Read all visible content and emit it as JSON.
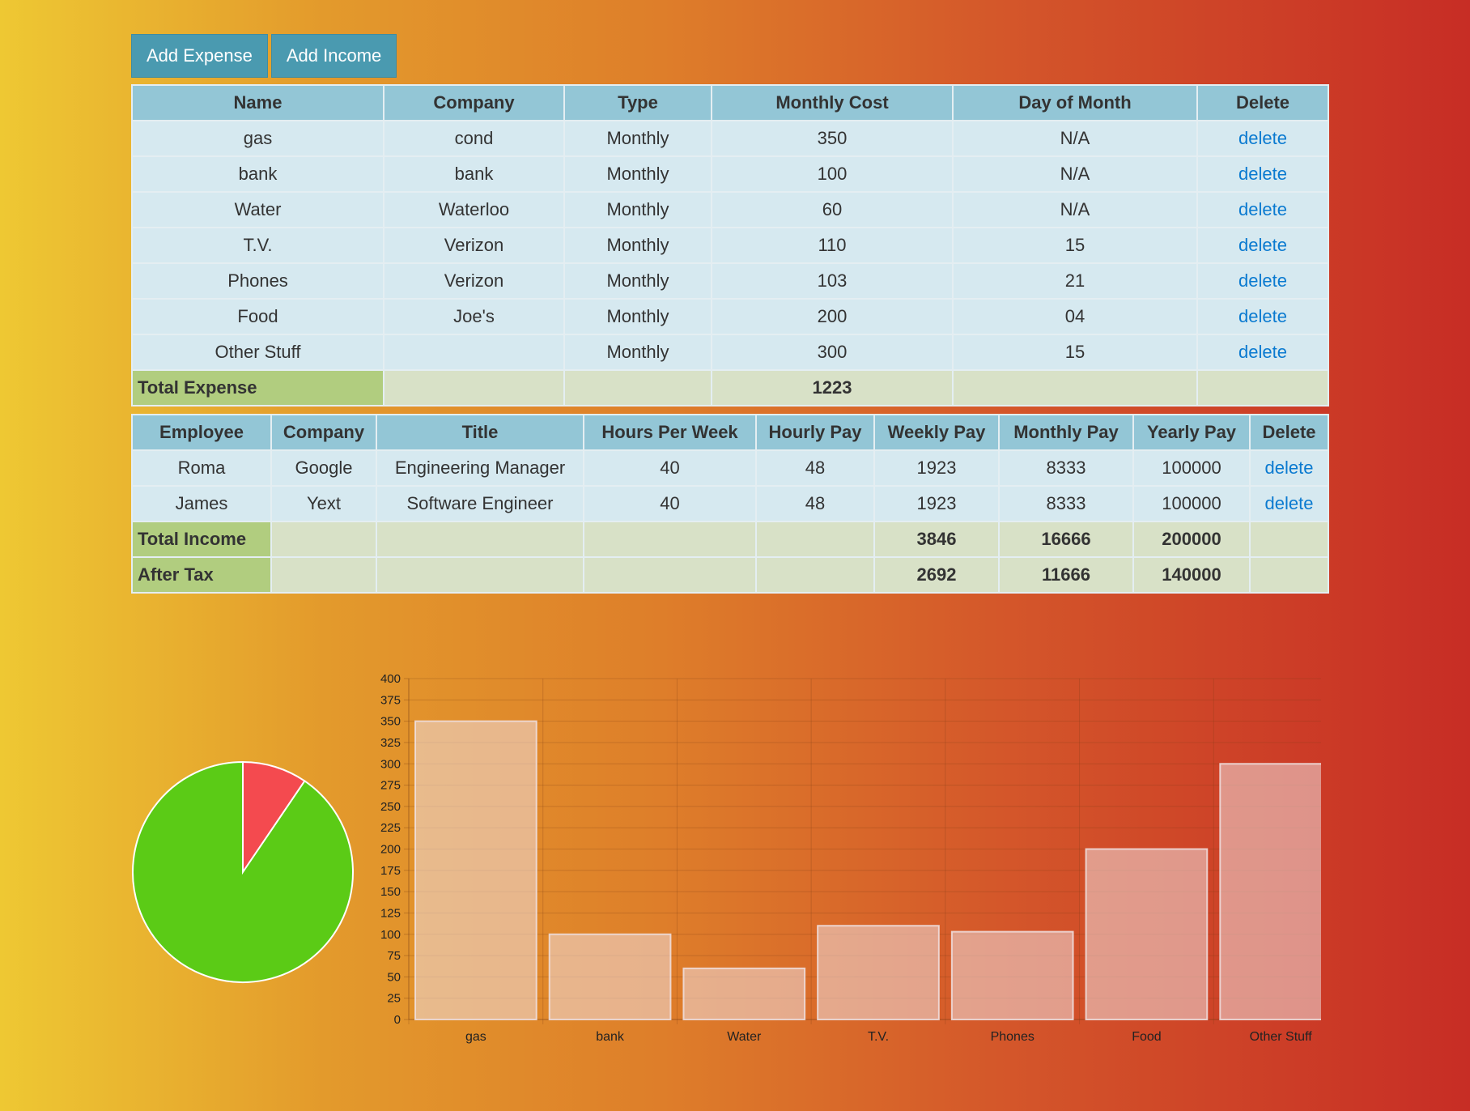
{
  "buttons": {
    "add_expense": "Add Expense",
    "add_income": "Add Income"
  },
  "expenses": {
    "headers": [
      "Name",
      "Company",
      "Type",
      "Monthly Cost",
      "Day of Month",
      "Delete"
    ],
    "rows": [
      {
        "name": "gas",
        "company": "cond",
        "type": "Monthly",
        "cost": "350",
        "day": "N/A",
        "action": "delete"
      },
      {
        "name": "bank",
        "company": "bank",
        "type": "Monthly",
        "cost": "100",
        "day": "N/A",
        "action": "delete"
      },
      {
        "name": "Water",
        "company": "Waterloo",
        "type": "Monthly",
        "cost": "60",
        "day": "N/A",
        "action": "delete"
      },
      {
        "name": "T.V.",
        "company": "Verizon",
        "type": "Monthly",
        "cost": "110",
        "day": "15",
        "action": "delete"
      },
      {
        "name": "Phones",
        "company": "Verizon",
        "type": "Monthly",
        "cost": "103",
        "day": "21",
        "action": "delete"
      },
      {
        "name": "Food",
        "company": "Joe's",
        "type": "Monthly",
        "cost": "200",
        "day": "04",
        "action": "delete"
      },
      {
        "name": "Other Stuff",
        "company": "",
        "type": "Monthly",
        "cost": "300",
        "day": "15",
        "action": "delete"
      }
    ],
    "total_label": "Total Expense",
    "total_value": "1223"
  },
  "income": {
    "headers": [
      "Employee",
      "Company",
      "Title",
      "Hours Per Week",
      "Hourly Pay",
      "Weekly Pay",
      "Monthly Pay",
      "Yearly Pay",
      "Delete"
    ],
    "rows": [
      {
        "employee": "Roma",
        "company": "Google",
        "title": "Engineering Manager",
        "hours": "40",
        "hourly": "48",
        "weekly": "1923",
        "monthly": "8333",
        "yearly": "100000",
        "action": "delete"
      },
      {
        "employee": "James",
        "company": "Yext",
        "title": "Software Engineer",
        "hours": "40",
        "hourly": "48",
        "weekly": "1923",
        "monthly": "8333",
        "yearly": "100000",
        "action": "delete"
      }
    ],
    "total": {
      "label": "Total Income",
      "weekly": "3846",
      "monthly": "16666",
      "yearly": "200000"
    },
    "after_tax": {
      "label": "After Tax",
      "weekly": "2692",
      "monthly": "11666",
      "yearly": "140000"
    }
  },
  "colors": {
    "pie_expense": "#f44a4f",
    "pie_income": "#5bcb16",
    "bar_fill": "rgba(238,220,220,0.55)",
    "bar_stroke": "rgba(240,225,225,0.85)"
  },
  "chart_data": [
    {
      "type": "pie",
      "slices": [
        {
          "value": 1223,
          "color": "#f44a4f"
        },
        {
          "value": 11666,
          "color": "#5bcb16"
        }
      ]
    },
    {
      "type": "bar",
      "categories": [
        "gas",
        "bank",
        "Water",
        "T.V.",
        "Phones",
        "Food",
        "Other Stuff"
      ],
      "values": [
        350,
        100,
        60,
        110,
        103,
        200,
        300
      ],
      "ylim": [
        0,
        400
      ],
      "yticks": [
        0,
        25,
        50,
        75,
        100,
        125,
        150,
        175,
        200,
        225,
        250,
        275,
        300,
        325,
        350,
        375,
        400
      ],
      "grid": true
    }
  ]
}
